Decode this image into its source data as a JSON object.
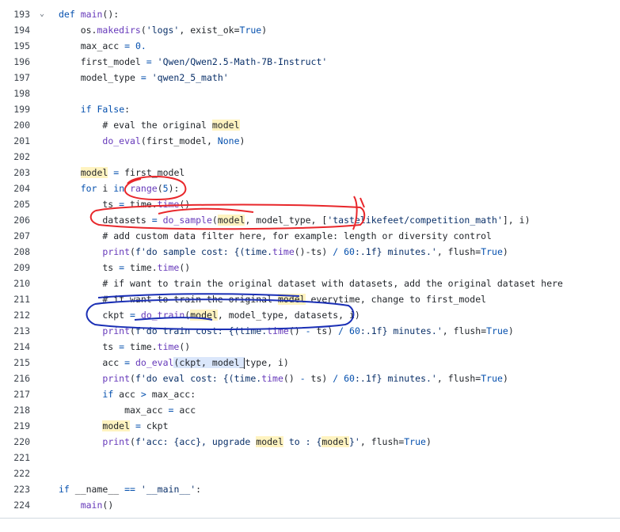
{
  "code_view": {
    "lines": [
      {
        "num": "193",
        "fold": "⌄",
        "tokens": [
          {
            "t": "def",
            "c": "kw"
          },
          {
            "t": " "
          },
          {
            "t": "main",
            "c": "fn"
          },
          {
            "t": "():"
          }
        ]
      },
      {
        "num": "194",
        "tokens": [
          {
            "t": "    os."
          },
          {
            "t": "makedirs",
            "c": "fn"
          },
          {
            "t": "("
          },
          {
            "t": "'logs'",
            "c": "str"
          },
          {
            "t": ", exist_ok="
          },
          {
            "t": "True",
            "c": "kw"
          },
          {
            "t": ")"
          }
        ]
      },
      {
        "num": "195",
        "tokens": [
          {
            "t": "    max_acc "
          },
          {
            "t": "=",
            "c": "kw"
          },
          {
            "t": " "
          },
          {
            "t": "0.",
            "c": "kw"
          }
        ]
      },
      {
        "num": "196",
        "tokens": [
          {
            "t": "    first_model "
          },
          {
            "t": "=",
            "c": "kw"
          },
          {
            "t": " "
          },
          {
            "t": "'Qwen/Qwen2.5-Math-7B-Instruct'",
            "c": "str"
          }
        ]
      },
      {
        "num": "197",
        "tokens": [
          {
            "t": "    model_type "
          },
          {
            "t": "=",
            "c": "kw"
          },
          {
            "t": " "
          },
          {
            "t": "'qwen2_5_math'",
            "c": "str"
          }
        ]
      },
      {
        "num": "198",
        "tokens": []
      },
      {
        "num": "199",
        "tokens": [
          {
            "t": "    "
          },
          {
            "t": "if",
            "c": "kw"
          },
          {
            "t": " "
          },
          {
            "t": "False",
            "c": "kw"
          },
          {
            "t": ":"
          }
        ]
      },
      {
        "num": "200",
        "tokens": [
          {
            "t": "        # eval the original "
          },
          {
            "t": "model",
            "c": "hl"
          }
        ]
      },
      {
        "num": "201",
        "tokens": [
          {
            "t": "        "
          },
          {
            "t": "do_eval",
            "c": "fn"
          },
          {
            "t": "(first_model, "
          },
          {
            "t": "None",
            "c": "kw"
          },
          {
            "t": ")"
          }
        ]
      },
      {
        "num": "202",
        "tokens": []
      },
      {
        "num": "203",
        "tokens": [
          {
            "t": "    "
          },
          {
            "t": "model",
            "c": "hl"
          },
          {
            "t": " "
          },
          {
            "t": "=",
            "c": "kw"
          },
          {
            "t": " first_model"
          }
        ]
      },
      {
        "num": "204",
        "tokens": [
          {
            "t": "    "
          },
          {
            "t": "for",
            "c": "kw"
          },
          {
            "t": " i "
          },
          {
            "t": "in",
            "c": "kw"
          },
          {
            "t": " "
          },
          {
            "t": "range",
            "c": "fn"
          },
          {
            "t": "("
          },
          {
            "t": "5",
            "c": "kw"
          },
          {
            "t": "):"
          }
        ]
      },
      {
        "num": "205",
        "tokens": [
          {
            "t": "        ts "
          },
          {
            "t": "=",
            "c": "kw"
          },
          {
            "t": " time."
          },
          {
            "t": "time",
            "c": "fn"
          },
          {
            "t": "()"
          }
        ]
      },
      {
        "num": "206",
        "tokens": [
          {
            "t": "        datasets "
          },
          {
            "t": "=",
            "c": "kw"
          },
          {
            "t": " "
          },
          {
            "t": "do_sample",
            "c": "fn"
          },
          {
            "t": "("
          },
          {
            "t": "model",
            "c": "hl"
          },
          {
            "t": ", model_type, ["
          },
          {
            "t": "'tastelikefeet/competition_math'",
            "c": "str"
          },
          {
            "t": "], i)"
          }
        ]
      },
      {
        "num": "207",
        "tokens": [
          {
            "t": "        # add custom data filter here, for example: length or diversity control"
          }
        ]
      },
      {
        "num": "208",
        "tokens": [
          {
            "t": "        "
          },
          {
            "t": "print",
            "c": "fn"
          },
          {
            "t": "("
          },
          {
            "t": "f'do sample cost: {(time.",
            "c": "str"
          },
          {
            "t": "time",
            "c": "fn"
          },
          {
            "t": "()-ts) "
          },
          {
            "t": "/",
            "c": "kw"
          },
          {
            "t": " "
          },
          {
            "t": "60",
            "c": "kw"
          },
          {
            "t": ":.1f} minutes.'",
            "c": "str"
          },
          {
            "t": ", flush="
          },
          {
            "t": "True",
            "c": "kw"
          },
          {
            "t": ")"
          }
        ]
      },
      {
        "num": "209",
        "tokens": [
          {
            "t": "        ts "
          },
          {
            "t": "=",
            "c": "kw"
          },
          {
            "t": " time."
          },
          {
            "t": "time",
            "c": "fn"
          },
          {
            "t": "()"
          }
        ]
      },
      {
        "num": "210",
        "tokens": [
          {
            "t": "        # if want to train the original dataset with datasets, add the original dataset here"
          }
        ]
      },
      {
        "num": "211",
        "tokens": [
          {
            "t": "        # if want to train the original "
          },
          {
            "t": "model",
            "c": "hl"
          },
          {
            "t": " everytime, change to first_model"
          }
        ]
      },
      {
        "num": "212",
        "tokens": [
          {
            "t": "        ckpt "
          },
          {
            "t": "=",
            "c": "kw"
          },
          {
            "t": " "
          },
          {
            "t": "do_train",
            "c": "fn"
          },
          {
            "t": "("
          },
          {
            "t": "model",
            "c": "hl"
          },
          {
            "t": ", model_type, datasets, i)"
          }
        ]
      },
      {
        "num": "213",
        "tokens": [
          {
            "t": "        "
          },
          {
            "t": "print",
            "c": "fn"
          },
          {
            "t": "("
          },
          {
            "t": "f'do train cost: {(time.",
            "c": "str"
          },
          {
            "t": "time",
            "c": "fn"
          },
          {
            "t": "() "
          },
          {
            "t": "-",
            "c": "kw"
          },
          {
            "t": " ts) "
          },
          {
            "t": "/",
            "c": "kw"
          },
          {
            "t": " "
          },
          {
            "t": "60",
            "c": "kw"
          },
          {
            "t": ":.1f} minutes.'",
            "c": "str"
          },
          {
            "t": ", flush="
          },
          {
            "t": "True",
            "c": "kw"
          },
          {
            "t": ")"
          }
        ]
      },
      {
        "num": "214",
        "tokens": [
          {
            "t": "        ts "
          },
          {
            "t": "=",
            "c": "kw"
          },
          {
            "t": " time."
          },
          {
            "t": "time",
            "c": "fn"
          },
          {
            "t": "()"
          }
        ]
      },
      {
        "num": "215",
        "tokens": [
          {
            "t": "        acc "
          },
          {
            "t": "=",
            "c": "kw"
          },
          {
            "t": " "
          },
          {
            "t": "do_eval",
            "c": "fn"
          },
          {
            "t": "(ckpt, model_",
            "c": "sel"
          },
          {
            "t": "",
            "c": "caret"
          },
          {
            "t": "type, i)"
          }
        ]
      },
      {
        "num": "216",
        "tokens": [
          {
            "t": "        "
          },
          {
            "t": "print",
            "c": "fn"
          },
          {
            "t": "("
          },
          {
            "t": "f'do eval cost: {(time.",
            "c": "str"
          },
          {
            "t": "time",
            "c": "fn"
          },
          {
            "t": "() "
          },
          {
            "t": "-",
            "c": "kw"
          },
          {
            "t": " ts) "
          },
          {
            "t": "/",
            "c": "kw"
          },
          {
            "t": " "
          },
          {
            "t": "60",
            "c": "kw"
          },
          {
            "t": ":.1f} minutes.'",
            "c": "str"
          },
          {
            "t": ", flush="
          },
          {
            "t": "True",
            "c": "kw"
          },
          {
            "t": ")"
          }
        ]
      },
      {
        "num": "217",
        "tokens": [
          {
            "t": "        "
          },
          {
            "t": "if",
            "c": "kw"
          },
          {
            "t": " acc "
          },
          {
            "t": ">",
            "c": "kw"
          },
          {
            "t": " max_acc:"
          }
        ]
      },
      {
        "num": "218",
        "tokens": [
          {
            "t": "            max_acc "
          },
          {
            "t": "=",
            "c": "kw"
          },
          {
            "t": " acc"
          }
        ]
      },
      {
        "num": "219",
        "tokens": [
          {
            "t": "        "
          },
          {
            "t": "model",
            "c": "hl"
          },
          {
            "t": " "
          },
          {
            "t": "=",
            "c": "kw"
          },
          {
            "t": " ckpt"
          }
        ]
      },
      {
        "num": "220",
        "tokens": [
          {
            "t": "        "
          },
          {
            "t": "print",
            "c": "fn"
          },
          {
            "t": "("
          },
          {
            "t": "f'acc: {acc}, upgrade ",
            "c": "str"
          },
          {
            "t": "model",
            "c": "hl"
          },
          {
            "t": " to : {",
            "c": "str"
          },
          {
            "t": "model",
            "c": "hl"
          },
          {
            "t": "}'",
            "c": "str"
          },
          {
            "t": ", flush="
          },
          {
            "t": "True",
            "c": "kw"
          },
          {
            "t": ")"
          }
        ]
      },
      {
        "num": "221",
        "tokens": []
      },
      {
        "num": "222",
        "tokens": []
      },
      {
        "num": "223",
        "tokens": [
          {
            "t": "if",
            "c": "kw"
          },
          {
            "t": " __name__ "
          },
          {
            "t": "==",
            "c": "kw"
          },
          {
            "t": " "
          },
          {
            "t": "'__main__'",
            "c": "str"
          },
          {
            "t": ":"
          }
        ]
      },
      {
        "num": "224",
        "tokens": [
          {
            "t": "    "
          },
          {
            "t": "main",
            "c": "fn"
          },
          {
            "t": "()"
          }
        ]
      }
    ],
    "colors": {
      "keyword": "#0550ae",
      "string": "#0a3069",
      "function": "#6639ba",
      "highlight": "#fff3c0",
      "red_ink": "#e8272b",
      "blue_ink": "#1a2fb5"
    }
  }
}
